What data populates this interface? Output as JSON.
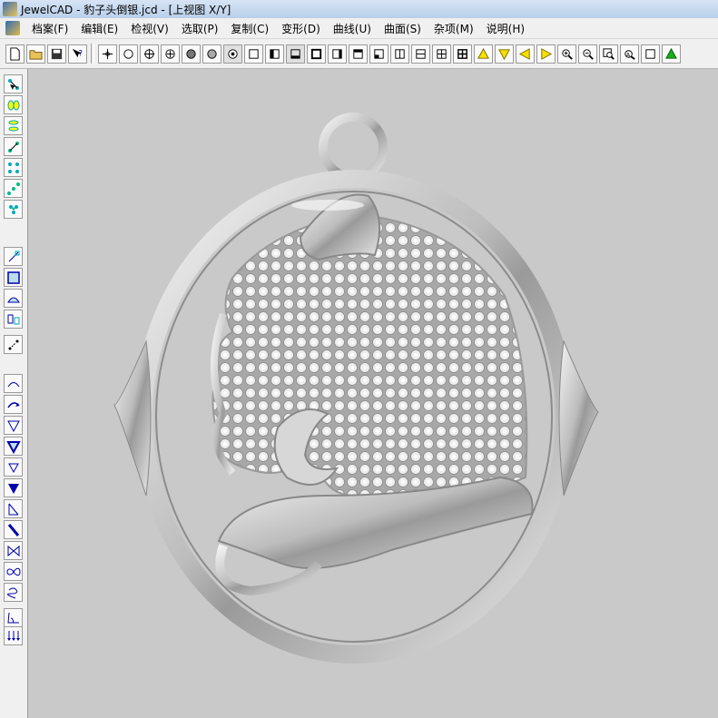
{
  "window": {
    "title": "JewelCAD - 豹子头倒银.jcd - [上视图 X/Y]"
  },
  "menu": {
    "items": [
      {
        "label": "档案(F)"
      },
      {
        "label": "编辑(E)"
      },
      {
        "label": "检视(V)"
      },
      {
        "label": "选取(P)"
      },
      {
        "label": "复制(C)"
      },
      {
        "label": "变形(D)"
      },
      {
        "label": "曲线(U)"
      },
      {
        "label": "曲面(S)"
      },
      {
        "label": "杂项(M)"
      },
      {
        "label": "说明(H)"
      }
    ]
  },
  "toolbar": {
    "groups": [
      [
        "new-file-icon",
        "open-folder-icon",
        "save-icon",
        "help-cursor-icon"
      ],
      [
        "point-cross-icon",
        "circle-icon",
        "circle-cross-icon",
        "circle-plus-icon",
        "filled-circle-icon",
        "gray-circle-icon",
        "radio-circle-icon",
        "square-icon",
        "half-square-left-icon",
        "view-top-icon",
        "view-front-icon",
        "view-right-icon",
        "view-back-icon",
        "view-bottom-icon",
        "split-vertical-icon",
        "split-horizontal-icon",
        "grid-four-icon",
        "grid-four-bold-icon",
        "arrow-up-yellow-icon",
        "arrow-down-yellow-icon",
        "arrow-left-yellow-icon",
        "arrow-right-yellow-icon",
        "zoom-in-icon",
        "zoom-out-icon",
        "zoom-window-icon",
        "zoom-previous-icon",
        "white-square-icon",
        "arrow-up-green-icon"
      ]
    ]
  },
  "sidebar": {
    "items": [
      "select-points-icon",
      "select-ellipse-icon",
      "select-stack-icon",
      "select-line-icon",
      "select-grid-icon",
      "select-diagonal-icon",
      "select-cluster-icon",
      "stretch-icon",
      "bounding-box-icon",
      "surface-icon",
      "mirror-copy-icon",
      "move-points-icon",
      "curve-open-icon",
      "curve-arrow-icon",
      "triangle-outline-icon",
      "triangle-blue-icon",
      "triangle-thin-icon",
      "triangle-filled-icon",
      "slant-line-icon",
      "slant-bold-icon",
      "bowtie-icon",
      "infinity-icon",
      "spiral-icon",
      "angle-icon",
      "arrows-down-icon"
    ]
  },
  "viewport": {
    "view_name": "上视图 X/Y",
    "background_color": "#c9c9c9",
    "model_color": "#d4d4d4"
  }
}
